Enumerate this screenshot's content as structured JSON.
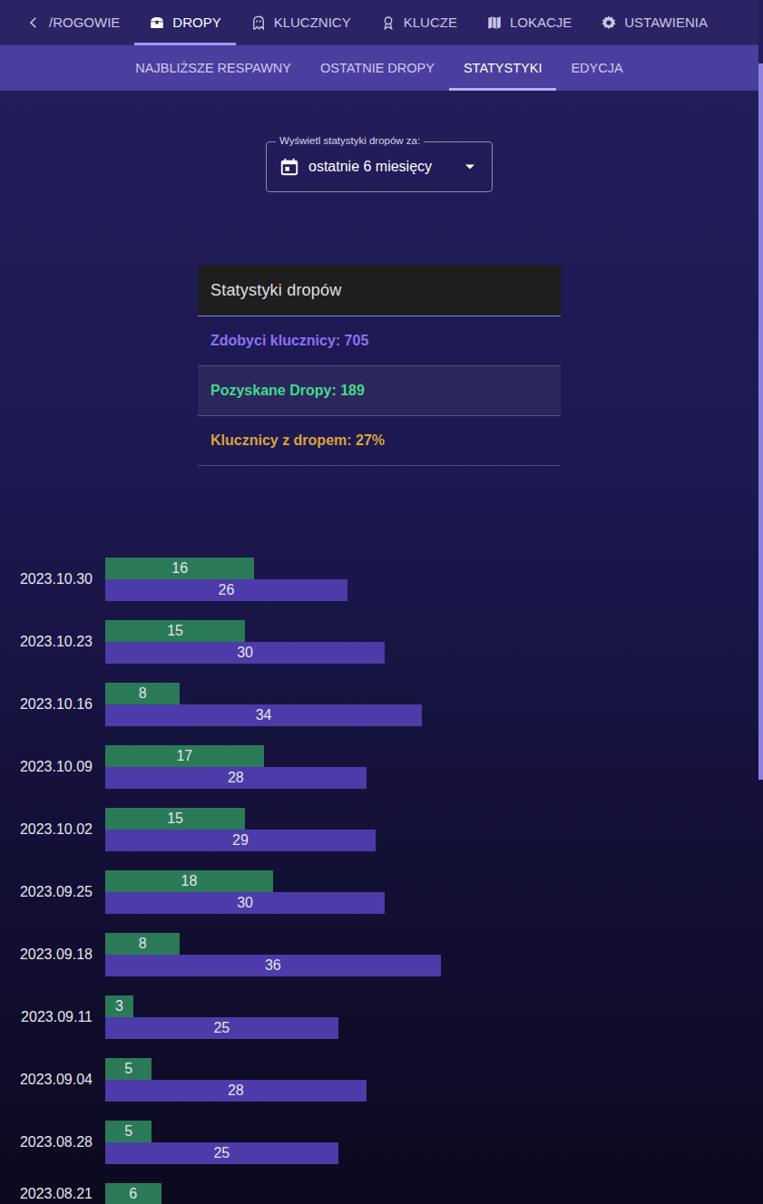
{
  "nav": {
    "tabs": [
      {
        "label": "/ROGOWIE",
        "selected": false,
        "icon": "back"
      },
      {
        "label": "DROPY",
        "selected": true,
        "icon": "chest"
      },
      {
        "label": "KLUCZNICY",
        "selected": false,
        "icon": "ghost"
      },
      {
        "label": "KLUCZE",
        "selected": false,
        "icon": "medal"
      },
      {
        "label": "LOKACJE",
        "selected": false,
        "icon": "map"
      },
      {
        "label": "USTAWIENIA",
        "selected": false,
        "icon": "gear"
      }
    ]
  },
  "subnav": {
    "tabs": [
      {
        "label": "NAJBLIŻSZE RESPAWNY",
        "selected": false
      },
      {
        "label": "OSTATNIE DROPY",
        "selected": false
      },
      {
        "label": "STATYSTYKI",
        "selected": true
      },
      {
        "label": "EDYCJA",
        "selected": false
      }
    ]
  },
  "filter": {
    "label": "Wyświetl statystyki dropów za:",
    "value": "ostatnie 6 miesięcy"
  },
  "stats": {
    "title": "Statystyki dropów",
    "rows": [
      {
        "text": "Zdobyci klucznicy: 705",
        "color": "#8d70f7"
      },
      {
        "text": "Pozyskane Dropy: 189",
        "color": "#3fdc8a"
      },
      {
        "text": "Klucznicy z dropem: 27%",
        "color": "#d9a43a"
      }
    ]
  },
  "chart": {
    "dates": [
      "2023.10.30",
      "2023.10.23",
      "2023.10.16",
      "2023.10.09",
      "2023.10.02",
      "2023.09.25",
      "2023.09.18",
      "2023.09.11",
      "2023.09.04",
      "2023.08.28",
      "2023.08.21"
    ],
    "series": [
      {
        "color": "#2b7a57",
        "values": [
          16,
          15,
          8,
          17,
          15,
          18,
          8,
          3,
          5,
          5,
          6
        ],
        "labels": [
          "16",
          "15",
          "8",
          "17",
          "15",
          "18",
          "8",
          "3",
          "5",
          "5",
          "6"
        ]
      },
      {
        "color": "#4c3ba8",
        "values": [
          26,
          30,
          34,
          28,
          29,
          30,
          36,
          25,
          28,
          25
        ],
        "labels": [
          "26",
          "30",
          "34",
          "28",
          "29",
          "30",
          "36",
          "25",
          "28",
          "25"
        ]
      }
    ]
  }
}
